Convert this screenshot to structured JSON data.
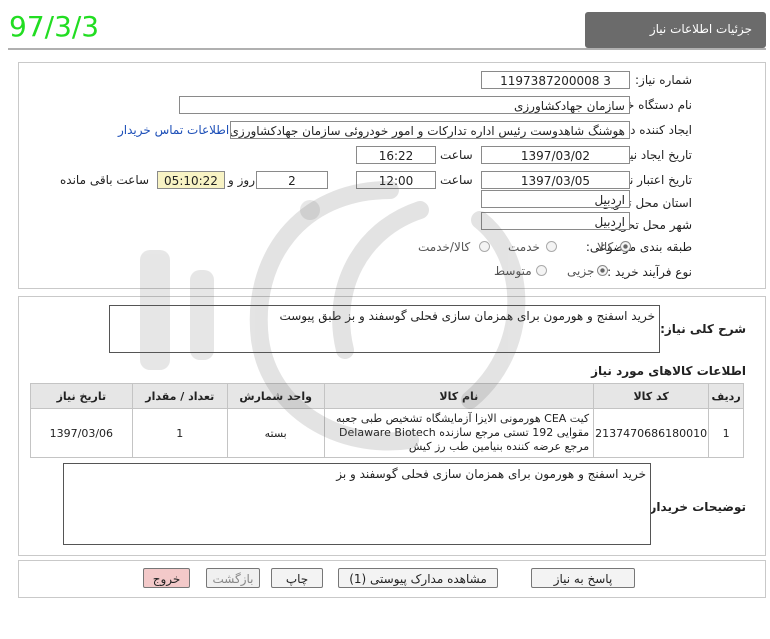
{
  "stamp": "97/3/3",
  "header": {
    "title": "جزئیات اطلاعات نیاز"
  },
  "form": {
    "need_number": {
      "label": "شماره نیاز:",
      "value": "1197387200008 3"
    },
    "buyer_org": {
      "label": "نام دستگاه خریدار:",
      "value": "سازمان جهادکشاورزی"
    },
    "requester": {
      "label": "ایجاد کننده درخواست:",
      "value": "هوشنگ شاهدوست رئیس اداره تدارکات و امور خودروئی سازمان جهادکشاورزی",
      "contact_link": "اطلاعات تماس خریدار"
    },
    "created": {
      "label": "تاریخ ایجاد نیاز:",
      "date": "1397/03/02",
      "time_label": "ساعت",
      "time": "16:22"
    },
    "valid_until": {
      "label": "تاریخ اعتبار نیاز:",
      "date": "1397/03/05",
      "time_label": "ساعت",
      "time": "12:00",
      "days": "2",
      "days_label": "روز و",
      "remaining": "05:10:22",
      "remaining_label": "ساعت باقی مانده"
    },
    "province": {
      "label": "استان محل تحویل:",
      "value": "اردبیل"
    },
    "city": {
      "label": "شهر محل تحویل:",
      "value": "اردبیل"
    },
    "category": {
      "label": "طبقه بندی موضوعی:",
      "options": [
        "کالا",
        "خدمت",
        "کالا/خدمت"
      ],
      "selected": "کالا"
    },
    "process": {
      "label": "نوع فرآیند خرید :",
      "options": [
        "جزیی",
        "متوسط"
      ],
      "selected": "جزیی"
    }
  },
  "summary": {
    "label": "شرح کلی نیاز:",
    "text": "خرید اسفنج و هورمون  برای همزمان سازی فحلی گوسفند و بز طبق پیوست"
  },
  "items_section": {
    "title": "اطلاعات کالاهای مورد نیاز",
    "columns": [
      "ردیف",
      "کد کالا",
      "نام کالا",
      "واحد شمارش",
      "تعداد / مقدار",
      "تاریخ نیاز"
    ],
    "rows": [
      {
        "row": "1",
        "code": "2137470686180010",
        "name": "کیت CEA هورمونی الایزا آزمایشگاه تشخیص طبی جعبه مقوایی 192 تستی مرجع سازنده Delaware Biotech مرجع عرضه کننده بنیامین طب رز کیش",
        "unit": "بسته",
        "qty": "1",
        "date": "1397/03/06"
      }
    ]
  },
  "buyer_notes": {
    "label": "توضیحات خریدار:",
    "text": "خرید اسفنج و هورمون  برای همزمان سازی فحلی گوسفند و بز"
  },
  "buttons": {
    "reply": "پاسخ به نیاز",
    "attachments": "مشاهده مدارک پیوستی (1)",
    "print": "چاپ",
    "back": "بازگشت",
    "exit": "خروج"
  },
  "colors": {
    "header_bg": "#6b6b6b",
    "stamp": "#22dd22",
    "link": "#1d4fb8",
    "remaining_bg": "#f8f3c4",
    "exit_bg": "#f3c9c9"
  }
}
